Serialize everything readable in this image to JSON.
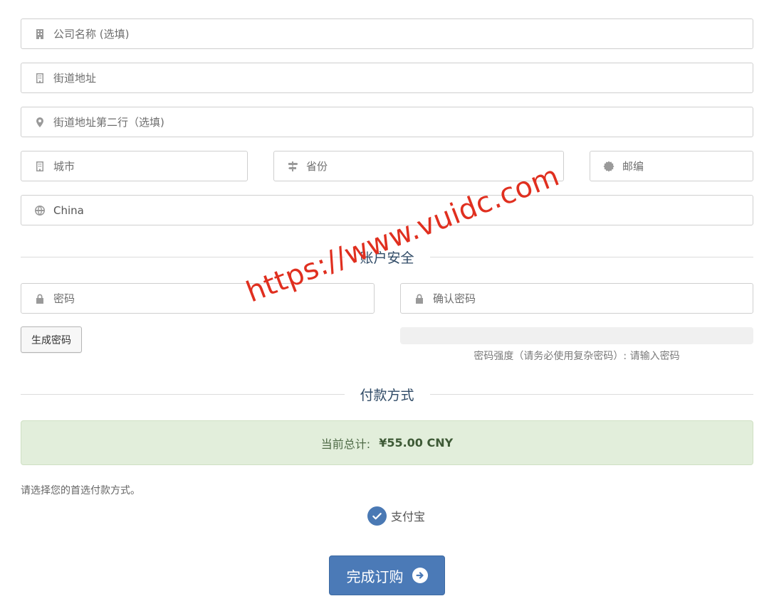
{
  "address": {
    "company_placeholder": "公司名称 (选填)",
    "street_placeholder": "街道地址",
    "street2_placeholder": "街道地址第二行（选填)",
    "city_placeholder": "城市",
    "state_placeholder": "省份",
    "postcode_placeholder": "邮编",
    "country_value": "China"
  },
  "security": {
    "title": "账户安全",
    "password_placeholder": "密码",
    "confirm_placeholder": "确认密码",
    "generate_label": "生成密码",
    "strength_text": "密码强度（请务必使用复杂密码）: 请输入密码"
  },
  "payment": {
    "title": "付款方式",
    "total_label": "当前总计:",
    "total_amount": "¥55.00 CNY",
    "hint": "请选择您的首选付款方式。",
    "method": "支付宝"
  },
  "submit_label": "完成订购",
  "watermark": "https://www.vuidc.com",
  "colors": {
    "accent": "#4b7ab7",
    "section_title": "#2f4a66",
    "total_bg": "#e2eedb",
    "watermark": "#e02f1f"
  }
}
